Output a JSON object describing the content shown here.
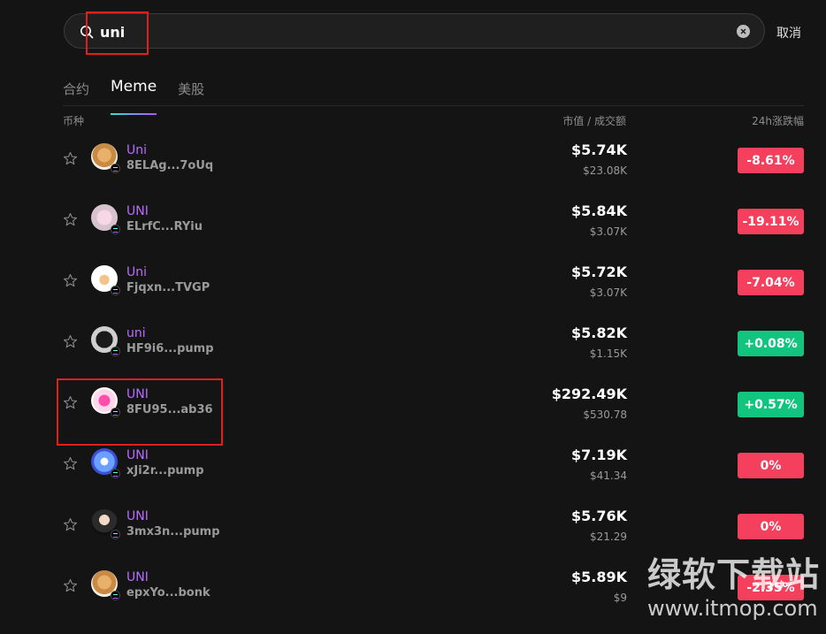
{
  "search": {
    "query": "uni",
    "cancel_label": "取消"
  },
  "tabs": [
    {
      "label": "合约",
      "active": false
    },
    {
      "label": "Meme",
      "active": true
    },
    {
      "label": "美股",
      "active": false
    }
  ],
  "columns": {
    "coin": "币种",
    "mcap_volume": "市值 / 成交额",
    "change_24h": "24h涨跌幅"
  },
  "colors": {
    "up": "#11c57e",
    "down": "#f5405d",
    "token_name": "#b86cff",
    "highlight": "#e0201c"
  },
  "rows": [
    {
      "name": "Uni",
      "address": "8ELAg...7oUq",
      "market_cap": "$5.74K",
      "volume": "$23.08K",
      "change": "-8.61%",
      "direction": "down",
      "avatar_icon": "shiba-dog-icon"
    },
    {
      "name": "UNI",
      "address": "ELrfC...RYiu",
      "market_cap": "$5.84K",
      "volume": "$3.07K",
      "change": "-19.11%",
      "direction": "down",
      "avatar_icon": "unicorn-doll-icon"
    },
    {
      "name": "Uni",
      "address": "Fjqxn...TVGP",
      "market_cap": "$5.72K",
      "volume": "$3.07K",
      "change": "-7.04%",
      "direction": "down",
      "avatar_icon": "cartoon-dog-icon"
    },
    {
      "name": "uni",
      "address": "HF9i6...pump",
      "market_cap": "$5.82K",
      "volume": "$1.15K",
      "change": "+0.08%",
      "direction": "up",
      "avatar_icon": "black-cat-icon"
    },
    {
      "name": "UNI",
      "address": "8FU95...ab36",
      "market_cap": "$292.49K",
      "volume": "$530.78",
      "change": "+0.57%",
      "direction": "up",
      "avatar_icon": "uniswap-unicorn-icon"
    },
    {
      "name": "UNI",
      "address": "xJi2r...pump",
      "market_cap": "$7.19K",
      "volume": "$41.34",
      "change": "0%",
      "direction": "down",
      "avatar_icon": "blue-orb-icon"
    },
    {
      "name": "UNI",
      "address": "3mx3n...pump",
      "market_cap": "$5.76K",
      "volume": "$21.29",
      "change": "0%",
      "direction": "down",
      "avatar_icon": "anime-girl-icon"
    },
    {
      "name": "UNI",
      "address": "epxYo...bonk",
      "market_cap": "$5.89K",
      "volume": "$9",
      "change": "-2.35%",
      "direction": "down",
      "avatar_icon": "shiba-dog-icon"
    }
  ],
  "watermark": {
    "line1": "绿软下载站",
    "line2": "www.itmop.com"
  }
}
